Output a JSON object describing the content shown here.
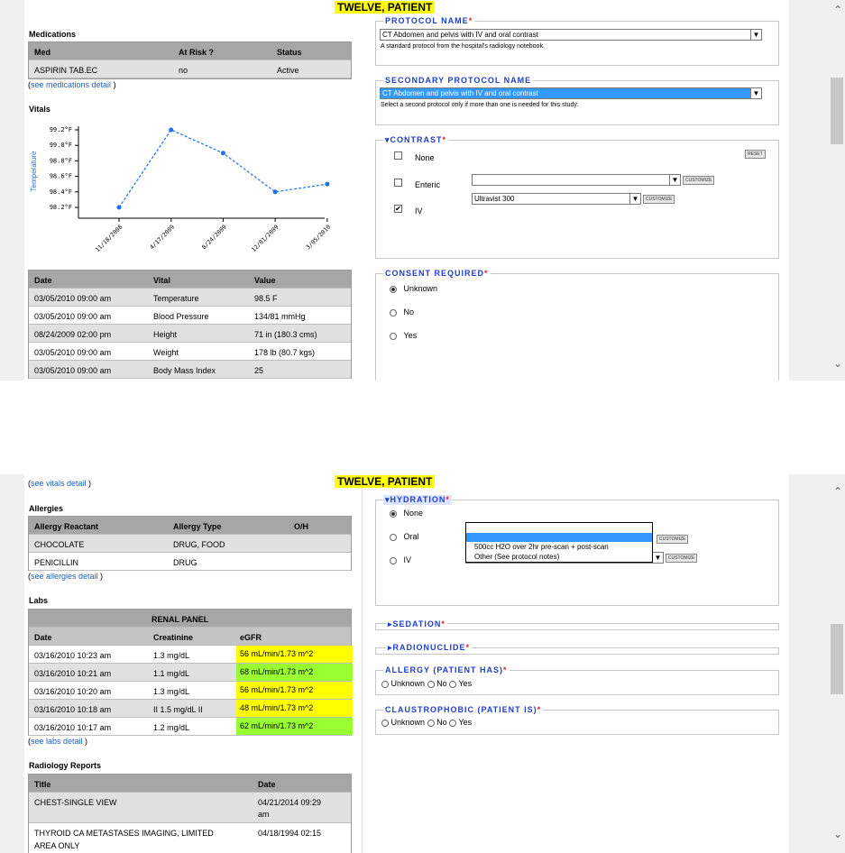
{
  "patient_name": "TWELVE, PATIENT",
  "top": {
    "medications": {
      "title": "Medications",
      "headers": [
        "Med",
        "At Risk ?",
        "Status"
      ],
      "rows": [
        [
          "ASPIRIN TAB.EC",
          "no",
          "Active"
        ]
      ],
      "detail_link": "see medications detail"
    },
    "vitals": {
      "title": "Vitals",
      "headers": [
        "Date",
        "Vital",
        "Value"
      ],
      "rows": [
        [
          "03/05/2010 09:00 am",
          "Temperature",
          "98.5 F"
        ],
        [
          "03/05/2010 09:00 am",
          "Blood Pressure",
          "134/81 mmHg"
        ],
        [
          "08/24/2009 02:00 pm",
          "Height",
          "71 in (180.3 cms)"
        ],
        [
          "03/05/2010 09:00 am",
          "Weight",
          "178 lb (80.7 kgs)"
        ],
        [
          "03/05/2010 09:00 am",
          "Body Mass Index",
          "25"
        ]
      ]
    },
    "protocol": {
      "name_label": "PROTOCOL NAME",
      "name_value": "CT Abdomen and pelvis with IV and oral contrast",
      "name_help": "A standard protocol from the hospital's radiology notebook.",
      "secondary_label": "SECONDARY PROTOCOL NAME",
      "secondary_value": "CT Abdomen and pelvis with IV and oral contrast",
      "secondary_help": "Select a second protocol only if more than one is needed for this study.",
      "contrast_label": "CONTRAST",
      "reset_label": "RESET",
      "contrast_options": [
        "None",
        "Enteric",
        "IV"
      ],
      "customize_label": "CUSTOMIZE",
      "iv_agent": "Ultravist 300",
      "consent_label": "CONSENT REQUIRED",
      "consent_options": [
        "Unknown",
        "No",
        "Yes"
      ],
      "consent_selected": "Unknown"
    }
  },
  "bottom": {
    "vitals_link": "see vitals detail",
    "allergies": {
      "title": "Allergies",
      "headers": [
        "Allergy Reactant",
        "Allergy Type",
        "O/H"
      ],
      "rows": [
        [
          "CHOCOLATE",
          "DRUG, FOOD",
          ""
        ],
        [
          "PENICILLIN",
          "DRUG",
          ""
        ]
      ],
      "detail_link": "see allergies detail"
    },
    "labs": {
      "title": "Labs",
      "panel": "RENAL PANEL",
      "headers": [
        "Date",
        "Creatinine",
        "eGFR"
      ],
      "rows": [
        [
          "03/16/2010 10:23 am",
          "1.3 mg/dL",
          "56 mL/min/1.73 m^2"
        ],
        [
          "03/16/2010 10:21 am",
          "1.1 mg/dL",
          "68 mL/min/1.73 m^2"
        ],
        [
          "03/16/2010 10:20 am",
          "1.3 mg/dL",
          "56 mL/min/1.73 m^2"
        ],
        [
          "03/16/2010 10:18 am",
          "II 1.5 mg/dL II",
          "48 mL/min/1.73 m^2"
        ],
        [
          "03/16/2010 10:17 am",
          "1.2 mg/dL",
          "62 mL/min/1.73 m^2"
        ]
      ],
      "egfr_colors": [
        "#ffff00",
        "#99ff33",
        "#ffff00",
        "#ffff00",
        "#99ff33"
      ],
      "detail_link": "see labs detail"
    },
    "radiology": {
      "title": "Radiology Reports",
      "headers": [
        "Title",
        "Date"
      ],
      "rows": [
        [
          "CHEST-SINGLE VIEW",
          "04/21/2014 09:29",
          "am"
        ],
        [
          "THYROID CA METASTASES IMAGING, LIMITED",
          "04/18/1994 02:15",
          ""
        ]
      ],
      "row2_cut": "AREA ONLY"
    },
    "hydration": {
      "label": "HYDRATION",
      "options": [
        "None",
        "Oral",
        "IV"
      ],
      "selected": "None",
      "dropdown_items": [
        "",
        "500cc H2O over 2hr pre-scan + post-scan",
        "Other (See protocol notes)"
      ],
      "customize_label": "CUSTOMIZE"
    },
    "sedation_label": "SEDATION",
    "radionuclide_label": "RADIONUCLIDE",
    "allergy_label": "ALLERGY (PATIENT HAS)",
    "claustro_label": "CLAUSTROPHOBIC (PATIENT IS)",
    "yn_options": [
      "Unknown",
      "No",
      "Yes"
    ]
  },
  "chart_data": {
    "type": "line",
    "title": "",
    "xlabel": "",
    "ylabel": "Temperature",
    "x": [
      "11/18/2008",
      "4/17/2009",
      "8/24/2009",
      "12/01/2009",
      "3/05/2010"
    ],
    "values": [
      98.2,
      99.2,
      98.9,
      98.4,
      98.5
    ],
    "y_ticks": [
      "99.2°F",
      "99.0°F",
      "98.8°F",
      "98.6°F",
      "98.4°F",
      "98.2°F"
    ],
    "ylim": [
      98.1,
      99.25
    ],
    "color": "#1e6ff0",
    "grid": false
  }
}
